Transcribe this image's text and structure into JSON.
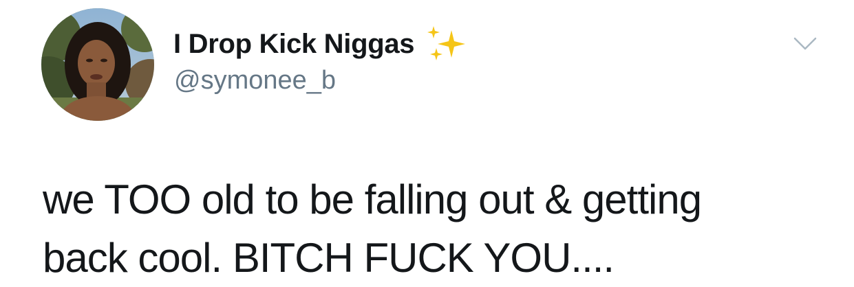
{
  "tweet": {
    "author": {
      "display_name": "I Drop Kick Niggas",
      "handle": "@symonee_b"
    },
    "text_lines": [
      "we TOO old to be falling out & getting",
      "back cool. BITCH FUCK YOU...."
    ],
    "icons": {
      "name_emoji": "sparkles-icon",
      "menu": "chevron-down-icon"
    },
    "colors": {
      "text": "#14171a",
      "handle": "#657786",
      "chevron": "#aab8c2",
      "sparkle": "#f5c518"
    }
  }
}
